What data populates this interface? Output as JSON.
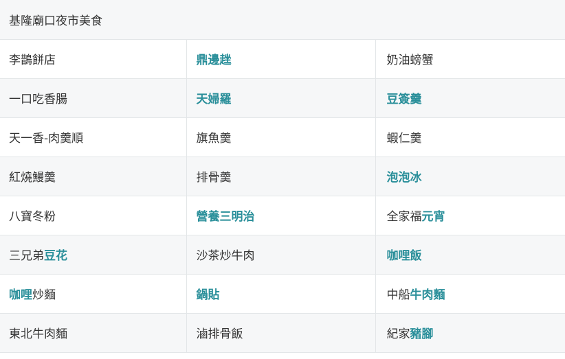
{
  "table": {
    "title": "基隆廟口夜市美食",
    "colors": {
      "link": "#2a8f9a",
      "text": "#333333",
      "stripe": "#f6f7f8",
      "border": "#e3e6e8"
    },
    "rows": [
      [
        [
          {
            "t": "李鵲餅店"
          }
        ],
        [
          {
            "t": "鼎邊趖",
            "link": true
          }
        ],
        [
          {
            "t": "奶油螃蟹"
          }
        ]
      ],
      [
        [
          {
            "t": "一口吃香腸"
          }
        ],
        [
          {
            "t": "天婦羅",
            "link": true
          }
        ],
        [
          {
            "t": "豆簽羹",
            "link": true
          }
        ]
      ],
      [
        [
          {
            "t": "天一香-肉羹順"
          }
        ],
        [
          {
            "t": "旗魚羹"
          }
        ],
        [
          {
            "t": "蝦仁羹"
          }
        ]
      ],
      [
        [
          {
            "t": "紅燒鰻羹"
          }
        ],
        [
          {
            "t": "排骨羹"
          }
        ],
        [
          {
            "t": "泡泡冰",
            "link": true
          }
        ]
      ],
      [
        [
          {
            "t": "八寶冬粉"
          }
        ],
        [
          {
            "t": "營養三明治",
            "link": true
          }
        ],
        [
          {
            "t": "全家福"
          },
          {
            "t": "元宵",
            "link": true
          }
        ]
      ],
      [
        [
          {
            "t": "三兄弟"
          },
          {
            "t": "豆花",
            "link": true
          }
        ],
        [
          {
            "t": "沙茶炒牛肉"
          }
        ],
        [
          {
            "t": "咖哩飯",
            "link": true
          }
        ]
      ],
      [
        [
          {
            "t": "咖哩",
            "link": true
          },
          {
            "t": "炒麵"
          }
        ],
        [
          {
            "t": "鍋貼",
            "link": true
          }
        ],
        [
          {
            "t": "中船"
          },
          {
            "t": "牛肉麵",
            "link": true
          }
        ]
      ],
      [
        [
          {
            "t": "東北牛肉麵"
          }
        ],
        [
          {
            "t": "滷排骨飯"
          }
        ],
        [
          {
            "t": "紀家"
          },
          {
            "t": "豬腳",
            "link": true
          }
        ]
      ]
    ]
  }
}
